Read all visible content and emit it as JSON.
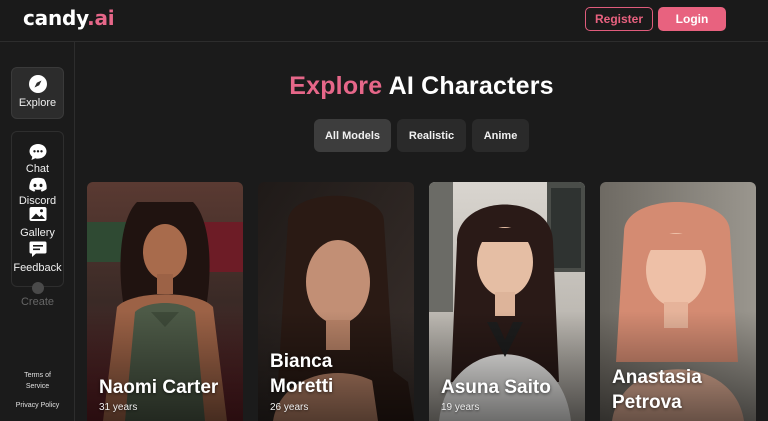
{
  "header": {
    "logo_main": "candy",
    "logo_accent": ".ai",
    "register_label": "Register",
    "login_label": "Login"
  },
  "sidebar": {
    "items": [
      {
        "label": "Explore",
        "icon": "compass-icon",
        "active": true
      },
      {
        "label": "Chat",
        "icon": "chat-bubble-icon"
      },
      {
        "label": "Discord",
        "icon": "discord-icon"
      },
      {
        "label": "Gallery",
        "icon": "gallery-icon"
      },
      {
        "label": "Feedback",
        "icon": "feedback-icon"
      },
      {
        "label": "Create",
        "icon": "create-icon",
        "disabled": true
      }
    ],
    "terms_line1": "Terms of",
    "terms_line2": "Service",
    "privacy": "Privacy Policy"
  },
  "main": {
    "title_accent": "Explore",
    "title_rest": "AI Characters",
    "tabs": [
      {
        "label": "All Models",
        "active": true
      },
      {
        "label": "Realistic"
      },
      {
        "label": "Anime"
      }
    ],
    "characters": [
      {
        "name_line1": "Naomi Carter",
        "age": "31 years"
      },
      {
        "name_line1": "Bianca",
        "name_line2": "Moretti",
        "age": "26 years"
      },
      {
        "name_line1": "Asuna Saito",
        "age": "19 years"
      },
      {
        "name_line1": "Anastasia",
        "name_line2": "Petrova",
        "age": ""
      }
    ]
  },
  "colors": {
    "accent": "#e66789",
    "background": "#1b1b1b",
    "tab_active": "#3d3d3d",
    "tab": "#2a2a2a"
  }
}
